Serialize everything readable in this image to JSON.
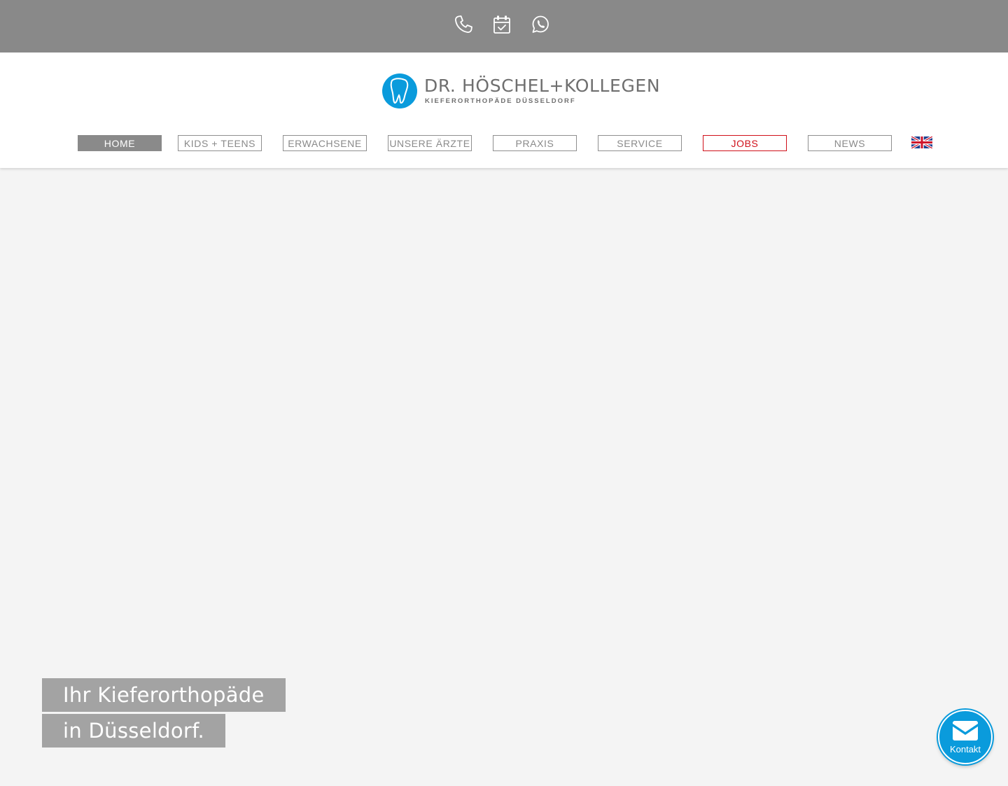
{
  "topbar": {
    "icons": [
      "phone-icon",
      "calendar-check-icon",
      "whatsapp-icon"
    ],
    "background": "#898989"
  },
  "logo": {
    "name": "DR. HÖSCHEL+KOLLEGEN",
    "subtitle": "KIEFERORTHOPÄDE  DÜSSELDORF",
    "brand_color": "#0a9bdc"
  },
  "nav": {
    "items": [
      {
        "label": "HOME",
        "active": true
      },
      {
        "label": "KIDS + TEENS"
      },
      {
        "label": "ERWACHSENE"
      },
      {
        "label": "UNSERE ÄRZTE"
      },
      {
        "label": "PRAXIS"
      },
      {
        "label": "SERVICE"
      },
      {
        "label": "JOBS",
        "highlight_color": "#d0101a"
      },
      {
        "label": "NEWS"
      }
    ],
    "language_icon": "uk-flag-icon"
  },
  "hero": {
    "line1": "Ihr Kieferorthopäde",
    "line2": "in Düsseldorf."
  },
  "contact_button": {
    "label": "Kontakt",
    "icon": "envelope-icon"
  }
}
